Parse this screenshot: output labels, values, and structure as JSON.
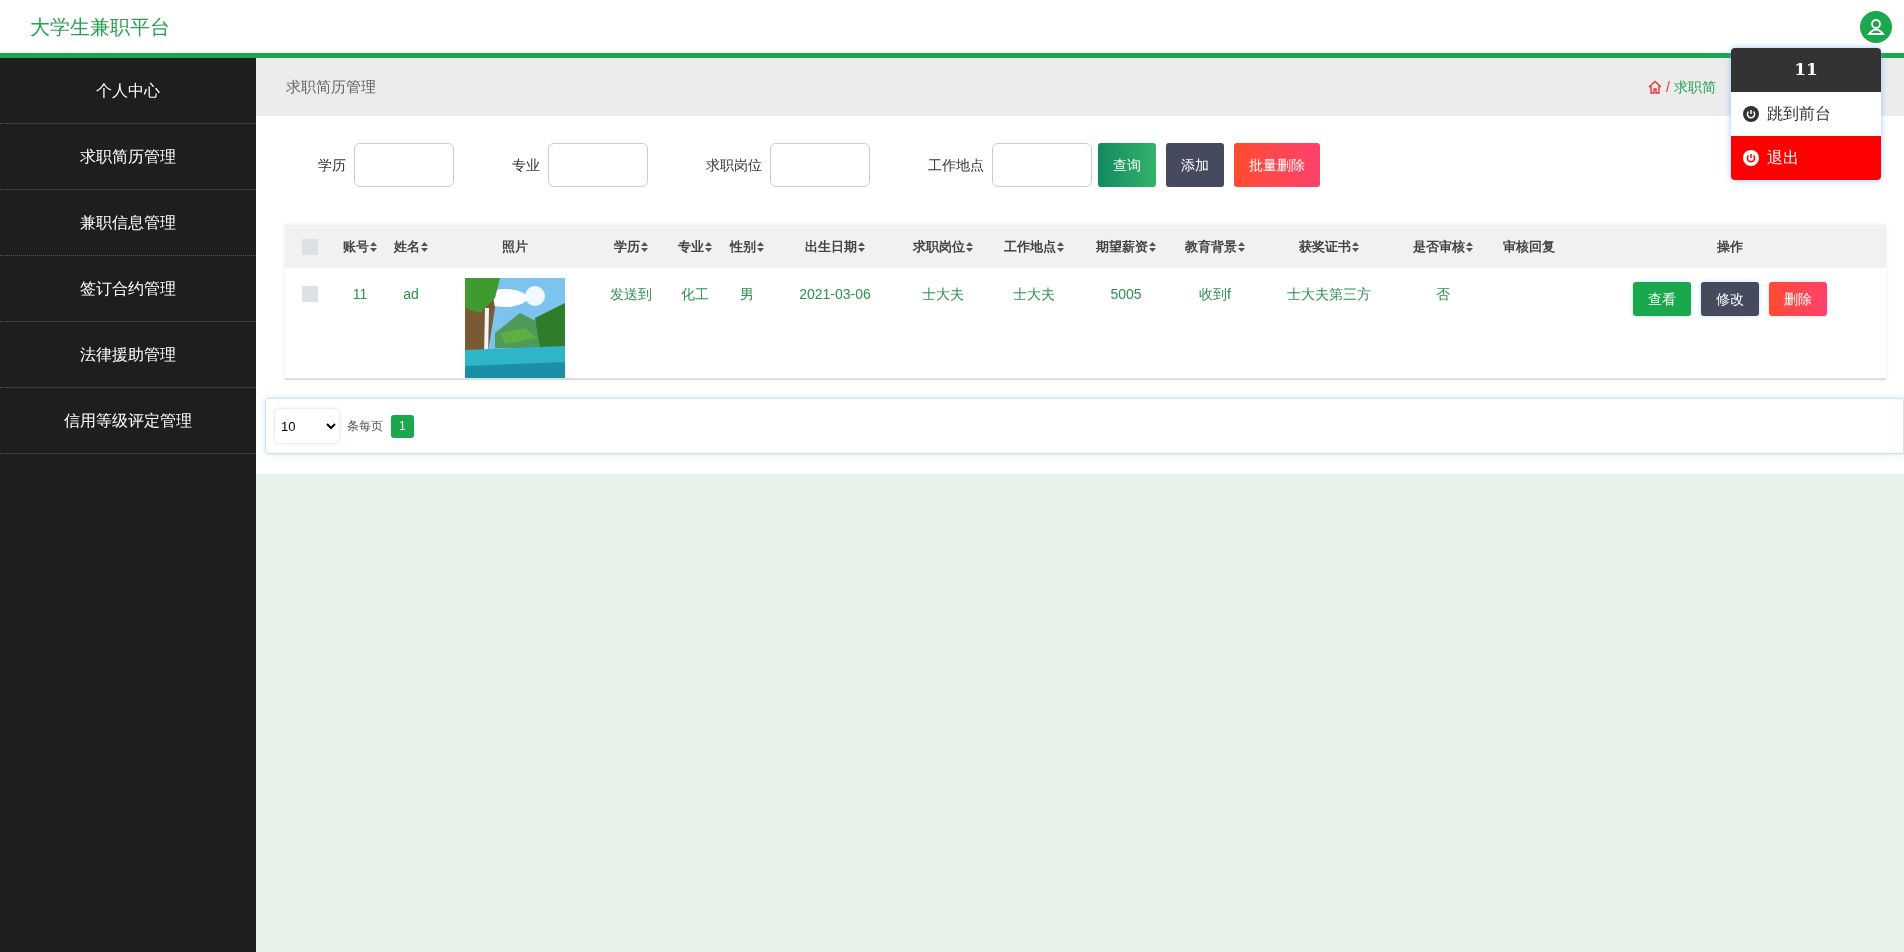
{
  "header": {
    "title": "大学生兼职平台"
  },
  "user_menu": {
    "username": "11",
    "items": [
      {
        "label": "跳到前台",
        "selected": false
      },
      {
        "label": "退出",
        "selected": true
      }
    ]
  },
  "sidebar": {
    "items": [
      {
        "label": "个人中心"
      },
      {
        "label": "求职简历管理"
      },
      {
        "label": "兼职信息管理"
      },
      {
        "label": "签订合约管理"
      },
      {
        "label": "法律援助管理"
      },
      {
        "label": "信用等级评定管理"
      }
    ]
  },
  "page_title": "求职简历管理",
  "breadcrumb": {
    "separator": "/",
    "visible_start": "求职简"
  },
  "search": {
    "fields": [
      {
        "label": "学历"
      },
      {
        "label": "专业"
      },
      {
        "label": "求职岗位"
      },
      {
        "label": "工作地点"
      }
    ],
    "buttons": [
      {
        "label": "查询",
        "kind": "query"
      },
      {
        "label": "添加",
        "kind": "add"
      },
      {
        "label": "批量删除",
        "kind": "delete"
      }
    ]
  },
  "table": {
    "select_all_checked": false,
    "columns": [
      {
        "label": "账号",
        "sortable": true
      },
      {
        "label": "姓名",
        "sortable": true
      },
      {
        "label": "照片",
        "sortable": false
      },
      {
        "label": "学历",
        "sortable": true
      },
      {
        "label": "专业",
        "sortable": true
      },
      {
        "label": "性别",
        "sortable": true
      },
      {
        "label": "出生日期",
        "sortable": true
      },
      {
        "label": "求职岗位",
        "sortable": true
      },
      {
        "label": "工作地点",
        "sortable": true
      },
      {
        "label": "期望薪资",
        "sortable": true
      },
      {
        "label": "教育背景",
        "sortable": true
      },
      {
        "label": "获奖证书",
        "sortable": true
      },
      {
        "label": "是否审核",
        "sortable": true
      },
      {
        "label": "审核回复",
        "sortable": false
      },
      {
        "label": "操作",
        "sortable": false
      }
    ],
    "rows": [
      {
        "checked": false,
        "cells": [
          "11",
          "ad",
          {
            "kind": "picture"
          },
          "发送到",
          "化工",
          "男",
          "2021-03-06",
          "士大夫",
          "士大夫",
          "5005",
          "收到f",
          "士大夫第三方",
          "否"
        ],
        "actions": [
          {
            "label": "查看",
            "kind": "view"
          },
          {
            "label": "修改",
            "kind": "edit"
          },
          {
            "label": "删除",
            "kind": "delete"
          }
        ]
      }
    ]
  },
  "pagination": {
    "page_size": "10",
    "per_page_label": "条每页",
    "pages": [
      {
        "label": "1",
        "selected": true
      }
    ]
  }
}
